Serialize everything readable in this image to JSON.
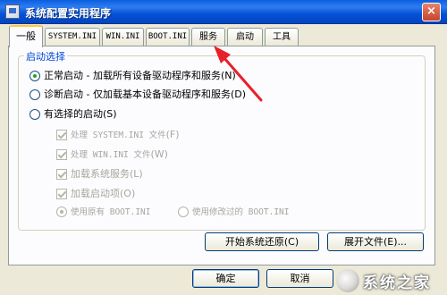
{
  "window": {
    "title": "系统配置实用程序",
    "close_glyph": "×"
  },
  "tabs": [
    "一般",
    "SYSTEM.INI",
    "WIN.INI",
    "BOOT.INI",
    "服务",
    "启动",
    "工具"
  ],
  "group_title": "启动选择",
  "startup_options": [
    {
      "label": "正常启动 - 加载所有设备驱动程序和服务",
      "key": "(N)"
    },
    {
      "label": "诊断启动 - 仅加载基本设备驱动程序和服务",
      "key": "(D)"
    },
    {
      "label": "有选择的启动",
      "key": "(S)"
    }
  ],
  "selective": {
    "items": [
      {
        "label": "处理 SYSTEM.INI 文件",
        "key": "(F)"
      },
      {
        "label": "处理 WIN.INI 文件",
        "key": "(W)"
      },
      {
        "label": "加载系统服务",
        "key": "(L)"
      },
      {
        "label": "加载启动项",
        "key": "(O)"
      }
    ],
    "boot_original": "使用原有 BOOT.INI",
    "boot_modified": "使用修改过的 BOOT.INI"
  },
  "buttons": {
    "restore": "开始系统还原(C)",
    "expand": "展开文件(E)...",
    "ok": "确定",
    "cancel": "取消"
  },
  "watermark": {
    "text": "系统之家"
  },
  "colors": {
    "titlebar": "#0a5fe0",
    "group_label": "#0046d5",
    "annotation_arrow": "#e8202a"
  }
}
